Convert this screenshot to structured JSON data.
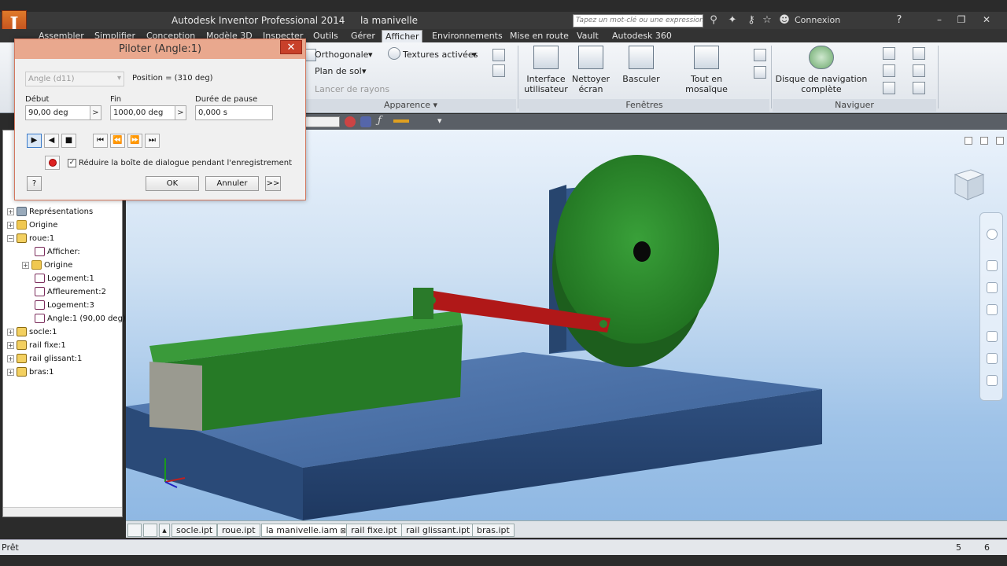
{
  "titlebar": {
    "app_title": "Autodesk Inventor Professional 2014",
    "doc_title": "la manivelle",
    "search_placeholder": "Tapez un mot-clé ou une expression",
    "signin": "Connexion"
  },
  "tabs": [
    "Assembler",
    "Simplifier",
    "Conception",
    "Modèle 3D",
    "Inspecter",
    "Outils",
    "Gérer",
    "Afficher",
    "Environnements",
    "Mise en route",
    "Vault",
    "Autodesk 360"
  ],
  "active_tab": "Afficher",
  "ribbon": {
    "orthographic": "Orthogonale",
    "ground_plane": "Plan de sol",
    "ray_tracing": "Lancer de rayons",
    "textures": "Textures activées",
    "appearance_panel": "Apparence",
    "ui_button": "Interface utilisateur",
    "clean_screen": "Nettoyer écran",
    "switch": "Basculer",
    "tile_all": "Tout en mosaïque",
    "windows_panel": "Fenêtres",
    "nav_wheel": "Disque de navigation complète",
    "navigate_panel": "Naviguer"
  },
  "browser": {
    "items": [
      {
        "label": "Représentations",
        "level": 0,
        "icon": "representations-icon"
      },
      {
        "label": "Origine",
        "level": 0,
        "icon": "folder-icon"
      },
      {
        "label": "roue:1",
        "level": 0,
        "icon": "part-icon"
      },
      {
        "label": "Afficher:",
        "level": 1,
        "icon": "view-icon"
      },
      {
        "label": "Origine",
        "level": 1,
        "icon": "folder-icon"
      },
      {
        "label": "Logement:1",
        "level": 1,
        "icon": "constraint-icon"
      },
      {
        "label": "Affleurement:2",
        "level": 1,
        "icon": "constraint-icon"
      },
      {
        "label": "Logement:3",
        "level": 1,
        "icon": "constraint-icon"
      },
      {
        "label": "Angle:1 (90,00 deg)",
        "level": 1,
        "icon": "angle-constraint-icon"
      },
      {
        "label": "socle:1",
        "level": 0,
        "icon": "part-icon"
      },
      {
        "label": "rail fixe:1",
        "level": 0,
        "icon": "part-icon"
      },
      {
        "label": "rail glissant:1",
        "level": 0,
        "icon": "part-icon"
      },
      {
        "label": "bras:1",
        "level": 0,
        "icon": "part-icon"
      }
    ]
  },
  "dialog": {
    "title": "Piloter (Angle:1)",
    "constraint_select": "Angle (d11)",
    "position": "Position = (310 deg)",
    "start_label": "Début",
    "start_value": "90,00 deg",
    "end_label": "Fin",
    "end_value": "1000,00 deg",
    "pause_label": "Durée de pause",
    "pause_value": "0,000 s",
    "record_option": "Réduire la boîte de dialogue pendant l'enregistrement",
    "record_checked": true,
    "ok": "OK",
    "cancel": "Annuler",
    "more": ">>"
  },
  "doc_tabs": [
    "socle.ipt",
    "roue.ipt",
    "la manivelle.iam",
    "rail fixe.ipt",
    "rail glissant.ipt",
    "bras.ipt"
  ],
  "active_doc_tab": "la manivelle.iam",
  "statusbar": {
    "status": "Prêt",
    "count_a": "5",
    "count_b": "6"
  },
  "colors": {
    "part_green": "#2e8a2e",
    "arm_red": "#b01818",
    "base_blue": "#3b5f96",
    "dialog_border": "#d3775e"
  }
}
